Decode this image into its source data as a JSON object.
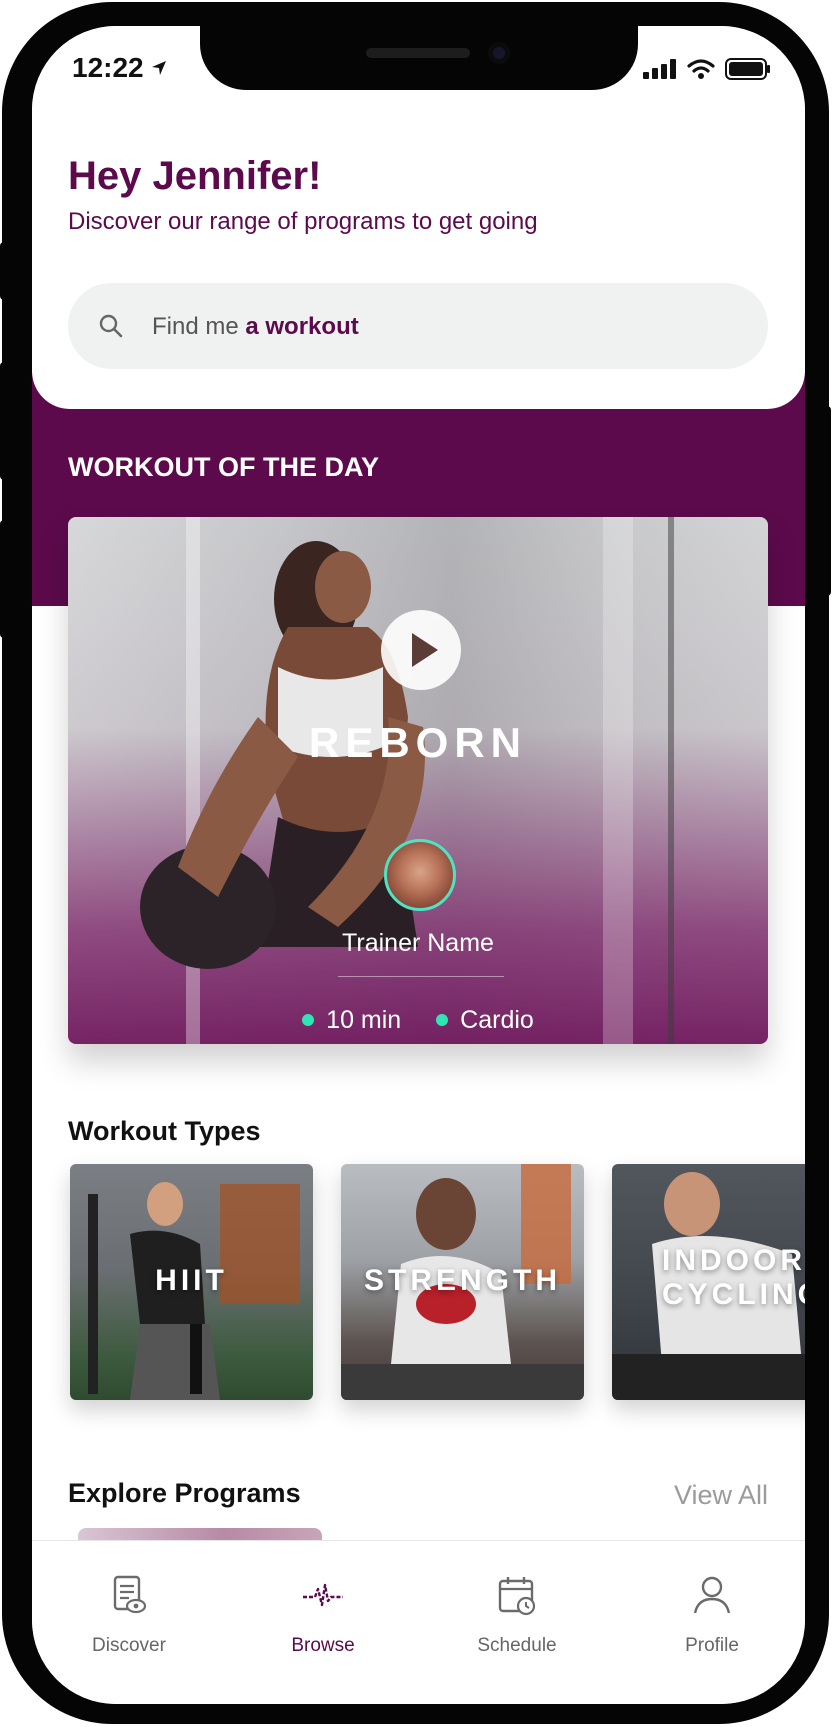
{
  "status_bar": {
    "time": "12:22"
  },
  "header": {
    "greeting": "Hey Jennifer!",
    "subtitle": "Discover our range of programs to get going",
    "search": {
      "text_prefix": "Find me ",
      "text_emphasis": "a workout"
    }
  },
  "workout_of_day": {
    "section_title": "WORKOUT OF THE DAY",
    "name": "REBORN",
    "trainer_name": "Trainer Name",
    "duration": "10 min",
    "category": "Cardio",
    "dot_color": "#2ee6b4"
  },
  "workout_types": {
    "section_title": "Workout Types",
    "items": [
      {
        "label": "HIIT"
      },
      {
        "label": "STRENGTH"
      },
      {
        "label_line1": "INDOOR",
        "label_line2": "CYCLING"
      }
    ]
  },
  "explore_programs": {
    "section_title": "Explore Programs",
    "view_all": "View All"
  },
  "tab_bar": {
    "items": [
      {
        "label": "Discover",
        "icon": "discover-icon"
      },
      {
        "label": "Browse",
        "icon": "pulse-icon",
        "active": true
      },
      {
        "label": "Schedule",
        "icon": "calendar-icon"
      },
      {
        "label": "Profile",
        "icon": "profile-icon"
      }
    ]
  },
  "colors": {
    "brand": "#5c0a4c",
    "accent": "#2ee6b4",
    "muted": "#9b9b9b"
  }
}
